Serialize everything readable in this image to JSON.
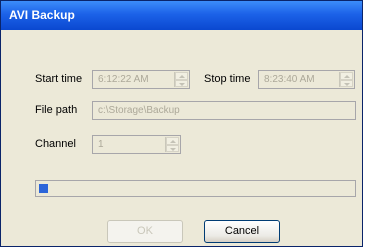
{
  "window": {
    "title": "AVI Backup"
  },
  "form": {
    "start_time_label": "Start time",
    "start_time_value": "6:12:22 AM",
    "stop_time_label": "Stop time",
    "stop_time_value": "8:23:40 AM",
    "file_path_label": "File path",
    "file_path_value": "c:\\Storage\\Backup",
    "channel_label": "Channel",
    "channel_value": "1"
  },
  "progress": {
    "fraction": 0.03
  },
  "buttons": {
    "ok_label": "OK",
    "cancel_label": "Cancel"
  },
  "colors": {
    "titlebar": "#0a48d0",
    "progress_fill": "#2c65d9",
    "window_bg": "#ece9d8"
  }
}
